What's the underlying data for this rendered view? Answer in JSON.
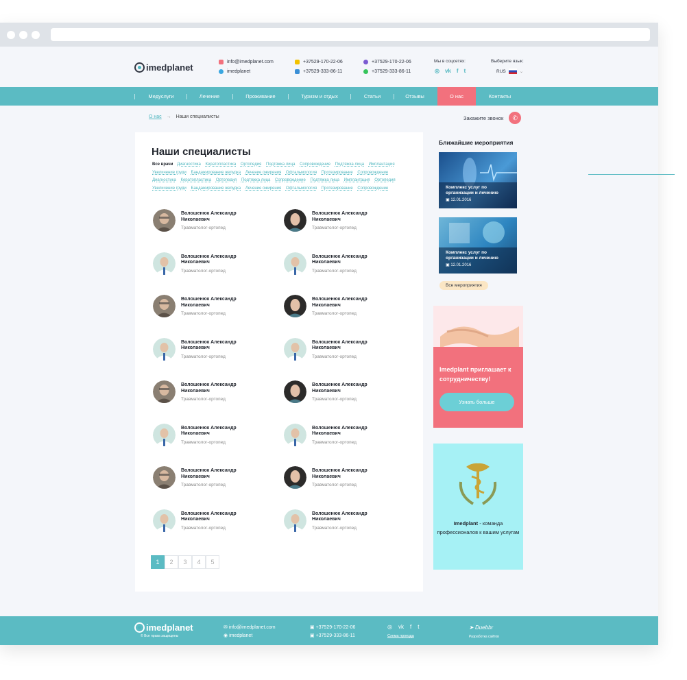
{
  "header": {
    "logo": "imedplanet",
    "email": "info@imedplanet.com",
    "skype": "imedplanet",
    "phones": [
      "+37529-170-22-06",
      "+37529-333-86-11",
      "+37529-170-22-06",
      "+37529-333-86-11"
    ],
    "social_label": "Мы в соцсетях:",
    "social": [
      "instagram-icon",
      "vk-icon",
      "facebook-icon",
      "twitter-icon"
    ],
    "lang_label": "Выберите язык:",
    "lang_value": "RUS"
  },
  "nav": [
    "Медуслуги",
    "Лечение",
    "Проживание",
    "Туризм и отдых",
    "Статьи",
    "Отзывы",
    "О нас",
    "Контакты"
  ],
  "nav_active": "О нас",
  "breadcrumb": {
    "parent": "О нас",
    "current": "Наши специалисты",
    "arrow": "→"
  },
  "callback": "Закажите звонок",
  "main": {
    "title": "Наши специалисты",
    "all_doctors": "Все врачи",
    "tags": [
      "Диагностика",
      "Кератопластика",
      "Ортопедия",
      "Подтяжка лица",
      "Сопровождение",
      "Подтяжка лица",
      "Имплантация",
      "Увеличение груди",
      "Бандажирование желудка",
      "Лечение ожирения",
      "Офтальмология",
      "Протезирование",
      "Сопровождение",
      "Диагностика",
      "Кератопластика",
      "Ортопедия",
      "Подтяжка лица",
      "Сопровождение",
      "Подтяжка лица",
      "Имплантация",
      "Ортопедия",
      "Увеличение груди",
      "Бандажирование желудка",
      "Лечение ожирения",
      "Офтальмология",
      "Протезирование",
      "Сопровождение"
    ],
    "doctors": [
      {
        "name": "Волошенюк Александр Николаевич",
        "role": "Травматолог-ортопед"
      },
      {
        "name": "Волошенюк Александр Николаевич",
        "role": "Травматолог-ортопед"
      },
      {
        "name": "Волошенюк Александр Николаевич",
        "role": "Травматолог-ортопед"
      },
      {
        "name": "Волошенюк Александр Николаевич",
        "role": "Травматолог-ортопед"
      },
      {
        "name": "Волошенюк Александр Николаевич",
        "role": "Травматолог-ортопед"
      },
      {
        "name": "Волошенюк Александр Николаевич",
        "role": "Травматолог-ортопед"
      },
      {
        "name": "Волошенюк Александр Николаевич",
        "role": "Травматолог-ортопед"
      },
      {
        "name": "Волошенюк Александр Николаевич",
        "role": "Травматолог-ортопед"
      },
      {
        "name": "Волошенюк Александр Николаевич",
        "role": "Травматолог-ортопед"
      },
      {
        "name": "Волошенюк Александр Николаевич",
        "role": "Травматолог-ортопед"
      },
      {
        "name": "Волошенюк Александр Николаевич",
        "role": "Травматолог-ортопед"
      },
      {
        "name": "Волошенюк Александр Николаевич",
        "role": "Травматолог-ортопед"
      },
      {
        "name": "Волошенюк Александр Николаевич",
        "role": "Травматолог-ортопед"
      },
      {
        "name": "Волошенюк Александр Николаевич",
        "role": "Травматолог-ортопед"
      },
      {
        "name": "Волошенюк Александр Николаевич",
        "role": "Травматолог-ортопед"
      },
      {
        "name": "Волошенюк Александр Николаевич",
        "role": "Травматолог-ортопед"
      }
    ],
    "pages": [
      "1",
      "2",
      "3",
      "4",
      "5"
    ],
    "active_page": "1"
  },
  "sidebar": {
    "title": "Ближайшие мероприятия",
    "events": [
      {
        "text": "Комплекс услуг по организации и лечению",
        "date": "12.01.2016"
      },
      {
        "text": "Комплекс услуг по организации и лечению",
        "date": "12.01.2016"
      }
    ],
    "all_events": "Все мероприятия",
    "promo_text": "Imedplant приглашает к сотрудничеству!",
    "promo_button": "Узнать больше",
    "about_brand": "Imedplant",
    "about_text": "- команда профессионалов к вашим услугам"
  },
  "footer": {
    "logo": "imedplanet",
    "copyright": "© Все права защищены",
    "email": "info@imedplanet.com",
    "skype": "imedplanet",
    "phones": [
      "+37529-170-22-06",
      "+37529-333-86-11"
    ],
    "sitemap": "Схема проезда",
    "dev": "Duebbr",
    "dev_label": "Разработка сайтов"
  },
  "colors": {
    "accent": "#5bbbc3",
    "pink": "#f2717d",
    "about_bg": "#a6f1f5"
  }
}
